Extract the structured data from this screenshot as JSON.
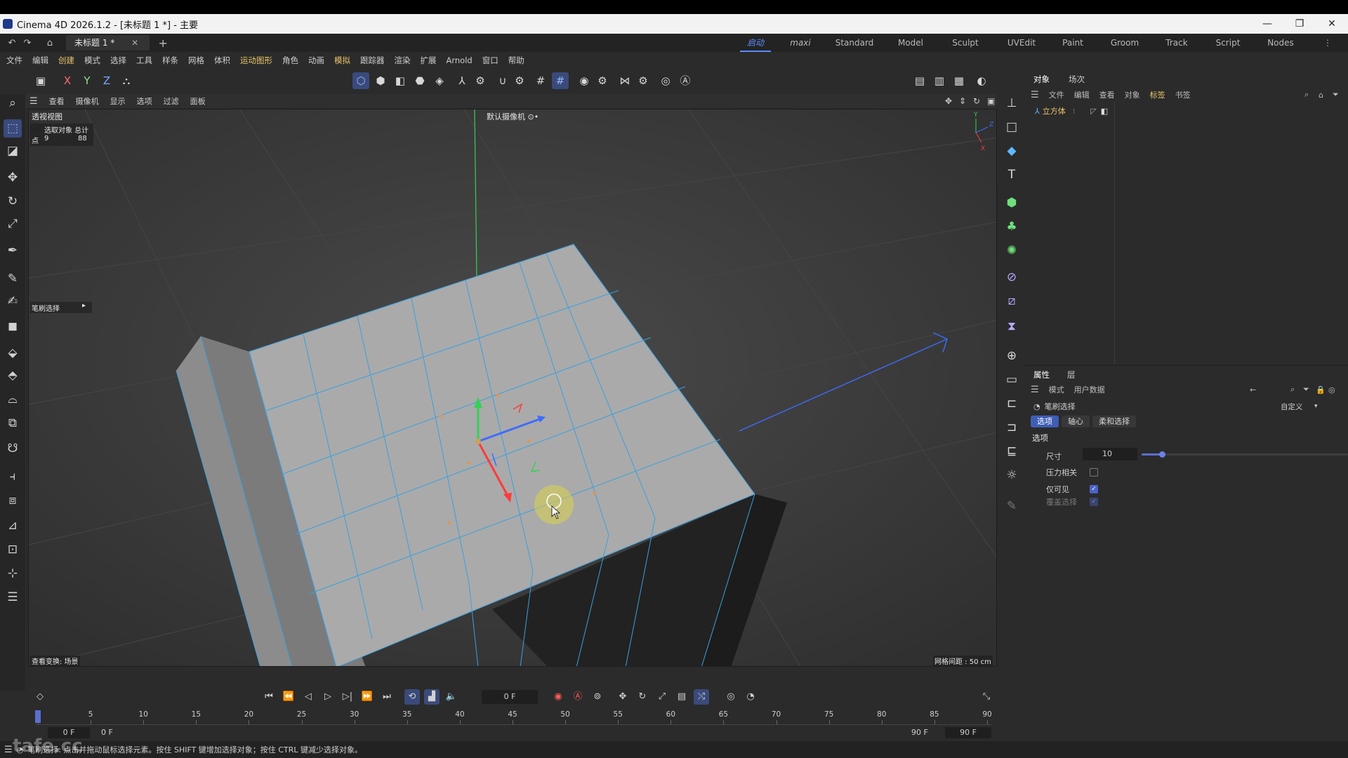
{
  "window": {
    "title": "Cinema 4D 2026.1.2 - [未标题 1 *] - 主要",
    "minimize": "—",
    "restore": "❐",
    "close": "✕"
  },
  "tabbar": {
    "doc_tab": "未标题 1 *",
    "close": "✕",
    "add": "+",
    "layouts": [
      "启动",
      "maxi",
      "Standard",
      "Model",
      "Sculpt",
      "UVEdit",
      "Paint",
      "Groom",
      "Track",
      "Script",
      "Nodes"
    ],
    "more": "⋮"
  },
  "menubar": [
    "文件",
    "编辑",
    "创建",
    "模式",
    "选择",
    "工具",
    "样条",
    "网格",
    "体积",
    "运动图形",
    "角色",
    "动画",
    "模拟",
    "跟踪器",
    "渲染",
    "扩展",
    "Arnold",
    "窗口",
    "帮助"
  ],
  "axes": {
    "x": "X",
    "y": "Y",
    "z": "Z"
  },
  "viewport": {
    "menu": [
      "查看",
      "摄像机",
      "显示",
      "选项",
      "过滤",
      "面板"
    ],
    "view_name": "透视视图",
    "camera_label": "默认摄像机 ⊙•",
    "hud": {
      "header": "选取对象 总计",
      "row_label": "点",
      "selected": "9",
      "total": "88"
    },
    "tool_label": "笔刷选择",
    "bottom_left": "查看变换: 场景",
    "bottom_right": "网格间距 : 50 cm"
  },
  "objects_panel": {
    "tabs": [
      "对象",
      "场次"
    ],
    "menu": [
      "文件",
      "编辑",
      "查看",
      "对象",
      "标签",
      "书签"
    ],
    "object_name": "立方体"
  },
  "attributes_panel": {
    "tabs": [
      "属性",
      "层"
    ],
    "menu": [
      "模式",
      "用户数据"
    ],
    "tool_name": "笔刷选择",
    "preset": "自定义",
    "subtabs": [
      "选项",
      "轴心",
      "柔和选择"
    ],
    "section": "选项",
    "size_label": "尺寸",
    "size_value": "10",
    "size_fraction": 0.1,
    "pressure_label": "压力相关",
    "pressure_checked": false,
    "visible_only_label": "仅可见",
    "visible_only_checked": true,
    "overwrite_label": "覆盖选择",
    "overwrite_checked": true
  },
  "timeline": {
    "current_frame": "0 F",
    "ticks": [
      "0",
      "5",
      "10",
      "15",
      "20",
      "25",
      "30",
      "35",
      "40",
      "45",
      "50",
      "55",
      "60",
      "65",
      "70",
      "75",
      "80",
      "85",
      "90"
    ],
    "start_a": "0 F",
    "start_b": "0 F",
    "end_a": "90 F",
    "end_b": "90 F"
  },
  "statusbar": {
    "message": "笔刷选择: 点击并拖动鼠标选择元素。按住 SHIFT 键增加选择对象；按住 CTRL 键减少选择对象。",
    "watermark": "tafe.cc"
  },
  "colors": {
    "accent": "#5b8cff",
    "menu_highlight": "#e9c46a",
    "edge": "#3aa0e0",
    "face": "#a9a9a9"
  }
}
